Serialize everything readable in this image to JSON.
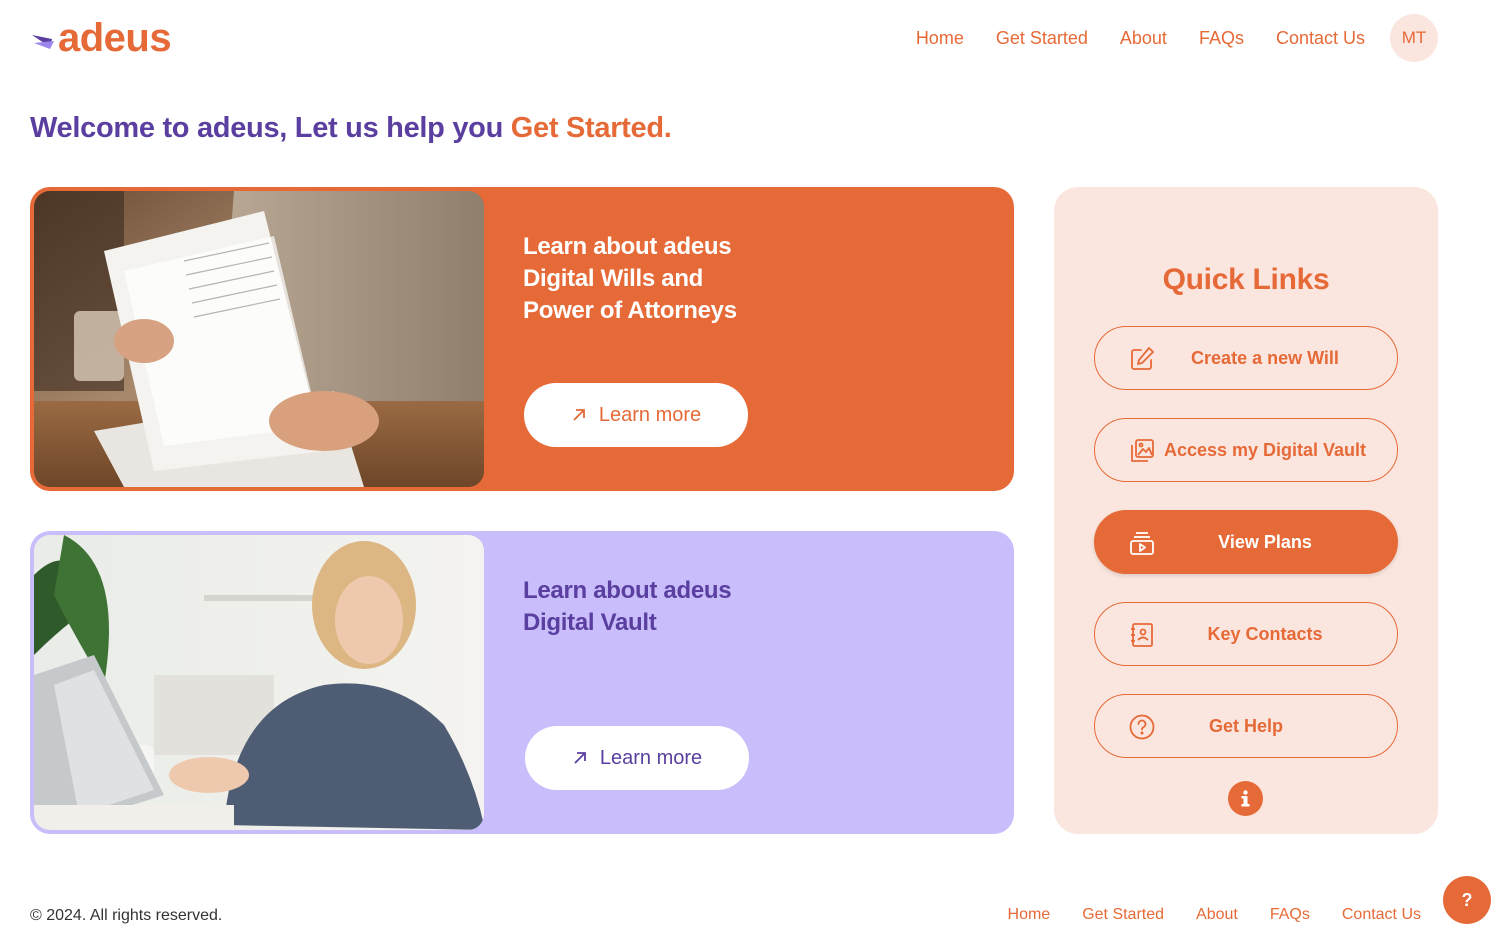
{
  "brand": {
    "name": "adeus"
  },
  "nav": {
    "items": [
      "Home",
      "Get Started",
      "About",
      "FAQs",
      "Contact Us"
    ],
    "avatar_initials": "MT"
  },
  "welcome": {
    "text": "Welcome to adeus, Let us help you",
    "highlight": "Get Started."
  },
  "cards": [
    {
      "title_lines": [
        "Learn about adeus",
        "Digital Wills and",
        "Power of Attorneys"
      ],
      "button": "Learn more",
      "image_icon": "person-reading-document-photo"
    },
    {
      "title_lines": [
        "Learn about adeus",
        "Digital Vault"
      ],
      "button": "Learn more",
      "image_icon": "woman-using-laptop-photo"
    }
  ],
  "quick_links": {
    "title": "Quick Links",
    "items": [
      {
        "label": "Create a new Will",
        "icon": "edit-icon"
      },
      {
        "label": "Access my Digital Vault",
        "icon": "gallery-icon"
      },
      {
        "label": "View Plans",
        "icon": "plans-icon",
        "active": true
      },
      {
        "label": "Key Contacts",
        "icon": "contacts-icon"
      },
      {
        "label": "Get Help",
        "icon": "help-circle-icon"
      }
    ],
    "info_icon": "info-icon"
  },
  "footer": {
    "copyright": "© 2024. All rights reserved.",
    "links": [
      "Home",
      "Get Started",
      "About",
      "FAQs",
      "Contact Us"
    ],
    "help_button": "?"
  },
  "colors": {
    "accent": "#e66a37",
    "purple": "#5a3fa0",
    "lavender": "#c9bdfb",
    "peach": "#fbe5df"
  }
}
